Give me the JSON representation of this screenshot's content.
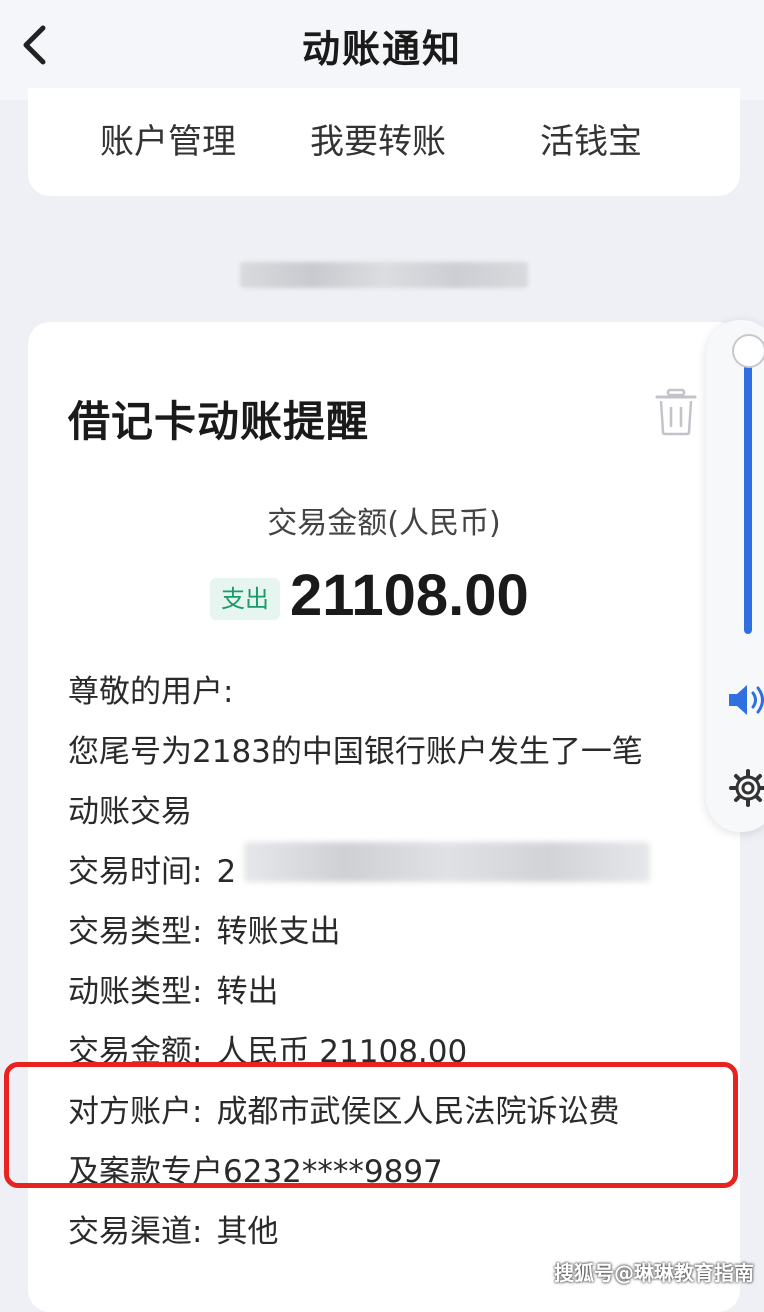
{
  "header": {
    "title": "动账通知",
    "back_icon": "chevron-left-icon"
  },
  "menu": {
    "items": [
      {
        "label": "账户管理"
      },
      {
        "label": "我要转账"
      },
      {
        "label": "活钱宝"
      }
    ]
  },
  "notice": {
    "title": "借记卡动账提醒",
    "delete_icon": "trash-icon",
    "amount_label": "交易金额(人民币)",
    "direction_badge": "支出",
    "amount": "21108.00",
    "greeting": "尊敬的用户:",
    "message_line1": "您尾号为2183的中国银行账户发生了一笔",
    "message_line2": "动账交易",
    "details": {
      "time_label": "交易时间:",
      "time_value_visible": "2",
      "type_label": "交易类型:",
      "type_value": "转账支出",
      "move_type_label": "动账类型:",
      "move_type_value": "转出",
      "amount_label": "交易金额:",
      "amount_value": "人民币 21108.00",
      "counterparty_label": "对方账户:",
      "counterparty_value_line1": "成都市武侯区人民法院诉讼费",
      "counterparty_value_line2": "及案款专户6232****9897",
      "channel_label": "交易渠道:",
      "channel_value": "其他"
    }
  },
  "volume_panel": {
    "level": 0.9,
    "speaker_icon": "speaker-icon",
    "settings_icon": "gear-icon"
  },
  "watermark": "搜狐号@琳琳教育指南",
  "colors": {
    "highlight": "#e8231f",
    "badge_bg": "#e6f5ef",
    "badge_text": "#1a9b6b",
    "volume_accent": "#2f6fe0"
  }
}
